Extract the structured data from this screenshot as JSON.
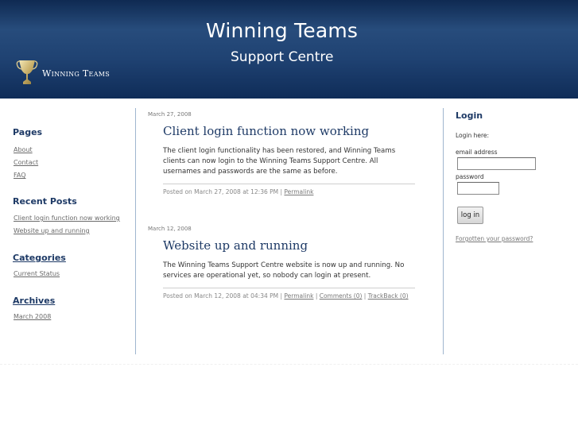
{
  "header": {
    "title": "Winning Teams",
    "subtitle": "Support Centre",
    "logo_text": "Winning Teams"
  },
  "sidebar": {
    "pages_heading": "Pages",
    "pages": [
      {
        "label": "About"
      },
      {
        "label": "Contact"
      },
      {
        "label": "FAQ"
      }
    ],
    "recent_heading": "Recent Posts",
    "recent": [
      {
        "label": "Client login function now working"
      },
      {
        "label": "Website up and running"
      }
    ],
    "categories_heading": "Categories",
    "categories": [
      {
        "label": "Current Status"
      }
    ],
    "archives_heading": "Archives",
    "archives": [
      {
        "label": "March 2008"
      }
    ]
  },
  "posts": [
    {
      "date": "March 27, 2008",
      "title": "Client login function now working",
      "body": "The client login functionality has been restored, and Winning Teams clients can now login to the Winning Teams Support Centre. All usernames and passwords are the same as before.",
      "meta_prefix": "Posted on March 27, 2008 at 12:36 PM |",
      "permalink": "Permalink"
    },
    {
      "date": "March 12, 2008",
      "title": "Website up and running",
      "body": "The Winning Teams Support Centre website is now up and running. No services are operational yet, so nobody can login at present.",
      "meta_prefix": "Posted on March 12, 2008 at 04:34 PM |",
      "permalink": "Permalink",
      "sep1": "|",
      "comments": "Comments (0)",
      "sep2": "|",
      "trackback": "TrackBack (0)"
    }
  ],
  "login": {
    "heading": "Login",
    "intro": "Login here:",
    "email_label": "email address",
    "email_value": "",
    "password_label": "password",
    "password_value": "",
    "button_label": "log in",
    "forgot_label": "Forgotten your password?"
  },
  "colors": {
    "header_gradient_top": "#0f2a52",
    "header_gradient_mid": "#274c7c",
    "heading_blue": "#1e3a66",
    "column_rule": "#9fb6cf"
  }
}
